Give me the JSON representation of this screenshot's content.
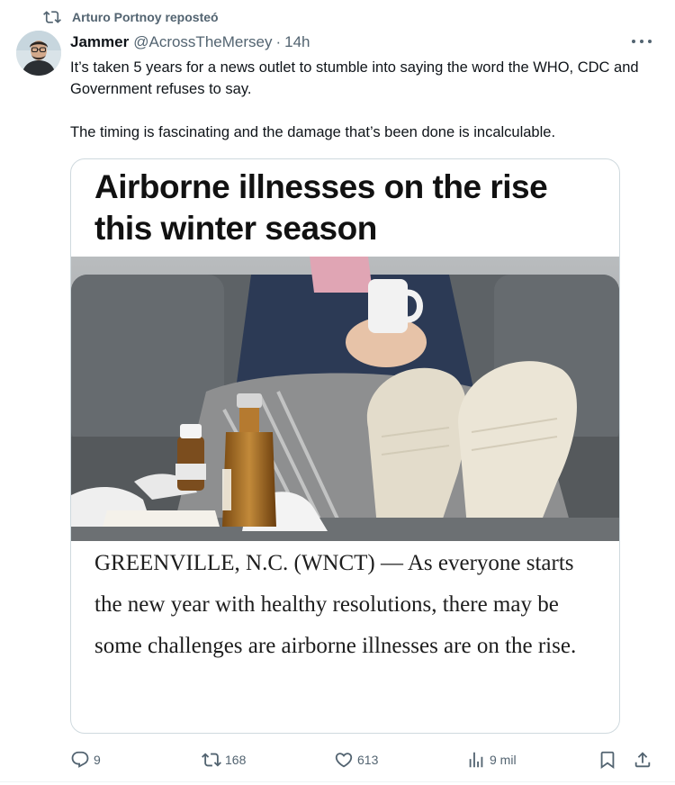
{
  "repost": {
    "text": "Arturo Portnoy reposteó",
    "icon": "repost-icon"
  },
  "author": {
    "name": "Jammer",
    "handle": "@AcrossTheMersey",
    "separator": "·",
    "time": "14h"
  },
  "tweet": {
    "paragraph_1": "It’s taken 5 years for a news outlet to stumble into saying the word the WHO, CDC and Government refuses to say.",
    "paragraph_2": "The timing is fascinating and the damage that’s been done is incalculable."
  },
  "card": {
    "headline": "Airborne illnesses on the rise this winter season",
    "body": "GREENVILLE, N.C. (WNCT) — As everyone starts the new year with healthy resolutions, there may be some challenges are airborne illnesses are on the rise."
  },
  "actions": {
    "replies": "9",
    "reposts": "168",
    "likes": "613",
    "views": "9 mil"
  },
  "colors": {
    "muted": "#536471",
    "text": "#0f1419",
    "border": "#cfd9de"
  }
}
